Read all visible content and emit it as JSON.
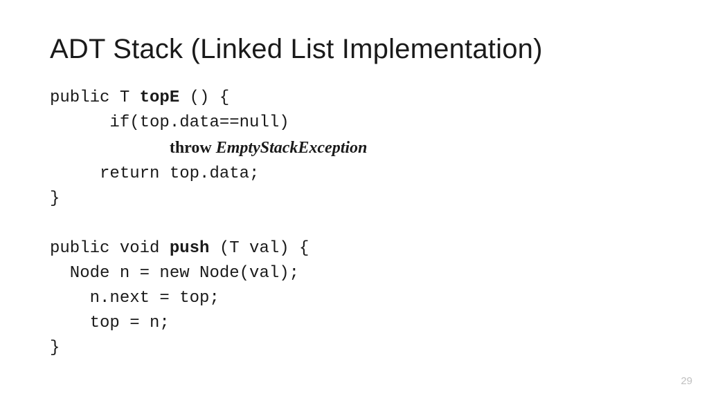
{
  "title": "ADT Stack (Linked List Implementation)",
  "code": {
    "l1a": "public T ",
    "l1b": "topE",
    "l1c": " () {",
    "l2": "      if(top.data==null)",
    "l3_indent": "            ",
    "l3_throw": "throw ",
    "l3_ex": "EmptyStackException",
    "l4": "     return top.data;",
    "l5": "}",
    "blank": " ",
    "l6a": "public void ",
    "l6b": "push",
    "l6c": " (T val) {",
    "l7": "  Node n = new Node(val);",
    "l8": "    n.next = top;",
    "l9": "    top = n;",
    "l10": "}"
  },
  "pagenum": "29"
}
